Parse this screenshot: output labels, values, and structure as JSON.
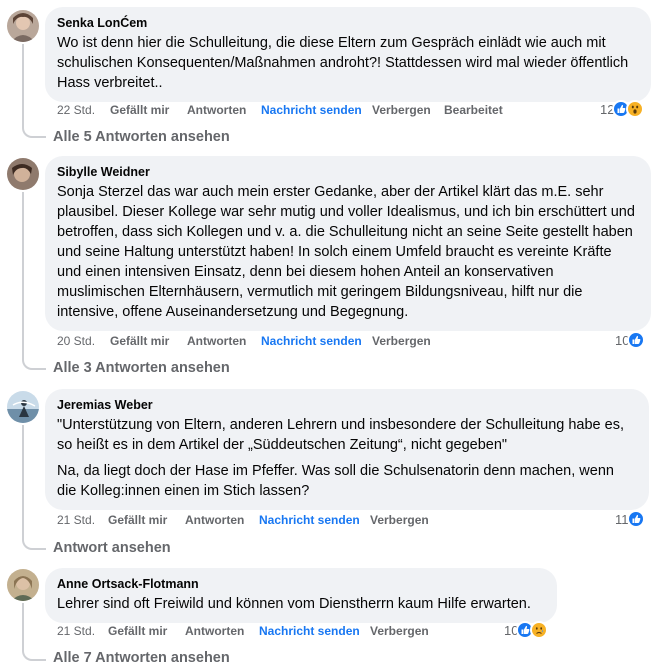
{
  "comments": [
    {
      "author": "Senka LonĆem",
      "paragraphs": [
        "Wo ist denn hier die Schulleitung, die diese Eltern zum Gespräch einlädt wie auch mit schulischen Konsequenten/Maßnahmen androht?! Stattdessen wird mal wieder öffentlich Hass verbreitet.."
      ],
      "time": "22 Std.",
      "like": "Gefällt mir",
      "reply": "Antworten",
      "message": "Nachricht senden",
      "hide": "Verbergen",
      "edited": "Bearbeitet",
      "reaction_count": "12",
      "reactions": [
        "like-icon",
        "wow-icon"
      ],
      "replies_link": "Alle 5 Antworten ansehen"
    },
    {
      "author": "Sibylle Weidner",
      "paragraphs": [
        "Sonja Sterzel das war auch mein erster Gedanke, aber der Artikel klärt das m.E. sehr plausibel. Dieser Kollege war sehr mutig und voller Idealismus, und ich bin erschüttert und betroffen, dass sich Kollegen und v. a. die Schulleitung nicht an seine Seite gestellt haben und seine Haltung unterstützt haben! In solch einem Umfeld braucht es vereinte Kräfte und einen intensiven Einsatz, denn bei diesem hohen Anteil an konservativen muslimischen Elternhäusern, vermutlich mit geringem Bildungsniveau, hilft nur die intensive, offene Auseinandersetzung und Begegnung."
      ],
      "time": "20 Std.",
      "like": "Gefällt mir",
      "reply": "Antworten",
      "message": "Nachricht senden",
      "hide": "Verbergen",
      "reaction_count": "10",
      "reactions": [
        "like-icon"
      ],
      "replies_link": "Alle 3 Antworten ansehen"
    },
    {
      "author": "Jeremias Weber",
      "paragraphs": [
        "\"Unterstützung von Eltern, anderen Lehrern und insbesondere der Schulleitung habe es, so heißt es in dem Artikel der „Süddeutschen Zeitung“, nicht gegeben\"",
        "Na, da liegt doch der Hase im Pfeffer. Was soll die Schulsenatorin denn machen, wenn die Kolleg:innen einen im Stich lassen?"
      ],
      "time": "21 Std.",
      "like": "Gefällt mir",
      "reply": "Antworten",
      "message": "Nachricht senden",
      "hide": "Verbergen",
      "reaction_count": "11",
      "reactions": [
        "like-icon"
      ],
      "replies_link": "Antwort ansehen"
    },
    {
      "author": "Anne Ortsack-Flotmann",
      "paragraphs": [
        "Lehrer sind oft Freiwild und können vom Dienstherrn kaum Hilfe erwarten."
      ],
      "time": "21 Std.",
      "like": "Gefällt mir",
      "reply": "Antworten",
      "message": "Nachricht senden",
      "hide": "Verbergen",
      "reaction_count": "10",
      "reactions": [
        "like-icon",
        "sad-icon"
      ],
      "replies_link": "Alle 7 Antworten ansehen"
    }
  ],
  "colors": {
    "bubble": "#f0f2f5",
    "meta": "#65676b",
    "link_blue": "#1877f2",
    "thread_line": "#ced0d4"
  }
}
